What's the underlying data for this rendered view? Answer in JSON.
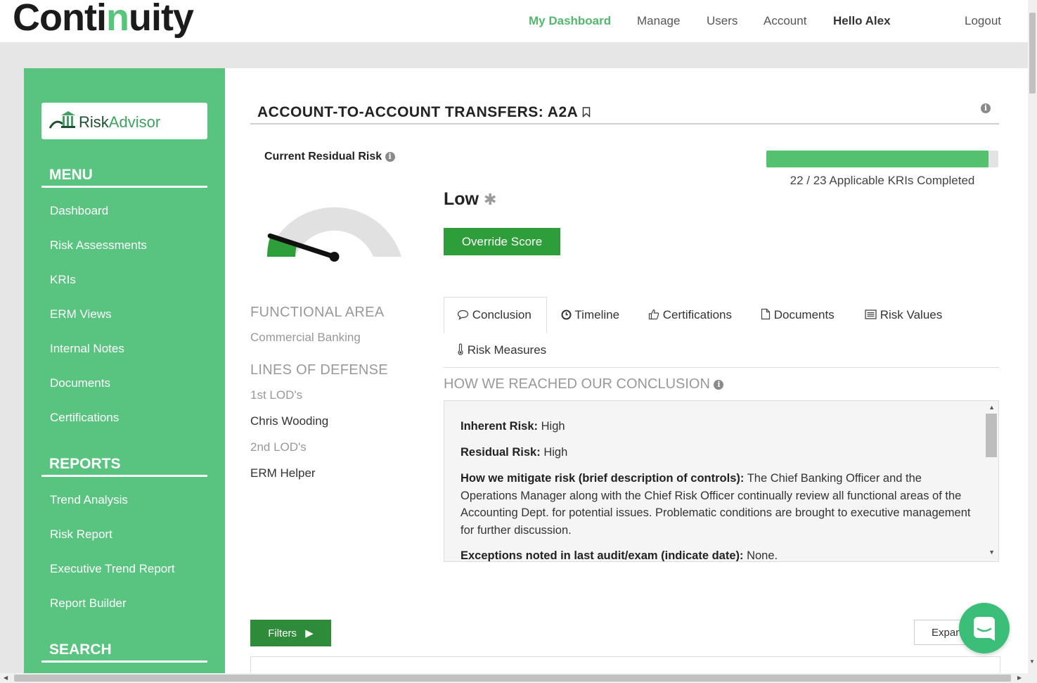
{
  "brand": {
    "name_start": "Conti",
    "name_mid": "n",
    "name_end": "uity"
  },
  "nav": {
    "dashboard": "My Dashboard",
    "manage": "Manage",
    "users": "Users",
    "account": "Account",
    "hello": "Hello Alex",
    "logout": "Logout"
  },
  "sidebar": {
    "product_risk": "Risk",
    "product_advisor": "Advisor",
    "menu_title": "MENU",
    "menu_items": [
      "Dashboard",
      "Risk Assessments",
      "KRIs",
      "ERM Views",
      "Internal Notes",
      "Documents",
      "Certifications"
    ],
    "reports_title": "REPORTS",
    "report_items": [
      "Trend Analysis",
      "Risk Report",
      "Executive Trend Report",
      "Report Builder"
    ],
    "search_title": "SEARCH"
  },
  "main": {
    "title": "ACCOUNT-TO-ACCOUNT TRANSFERS: A2A",
    "current_residual_risk_label": "Current Residual Risk",
    "risk_level": "Low",
    "gauge_value": 0.1,
    "override_button": "Override Score",
    "kri_completed": 22,
    "kri_total": 23,
    "kri_text": "22 / 23 Applicable KRIs Completed",
    "functional_area_label": "FUNCTIONAL AREA",
    "functional_area_value": "Commercial Banking",
    "lines_of_defense_label": "LINES OF DEFENSE",
    "lod1_label": "1st LOD's",
    "lod1_name": "Chris Wooding",
    "lod2_label": "2nd LOD's",
    "lod2_name": "ERM Helper",
    "tabs": {
      "conclusion": "Conclusion",
      "timeline": "Timeline",
      "certifications": "Certifications",
      "documents": "Documents",
      "risk_values": "Risk Values",
      "risk_measures": "Risk Measures"
    },
    "conclusion_heading": "HOW WE REACHED OUR CONCLUSION",
    "conclusion": {
      "inherent_label": "Inherent Risk:",
      "inherent_value": "High",
      "residual_label": "Residual Risk:",
      "residual_value": "High",
      "mitigate_label": "How we mitigate risk (brief description of controls):",
      "mitigate_value": "The Chief Banking Officer and the Operations Manager along with the Chief Risk Officer continually review all functional areas of the Accounting Dept. for potential issues. Problematic conditions are brought to executive management for further discussion.",
      "exceptions_label": "Exceptions noted in last audit/exam (indicate date):",
      "exceptions_value": "None."
    },
    "filters_button": "Filters",
    "expand_button": "Expan"
  },
  "colors": {
    "brand_green": "#58c47f",
    "button_green": "#2e9e3a",
    "progress_green": "#54c16f"
  }
}
